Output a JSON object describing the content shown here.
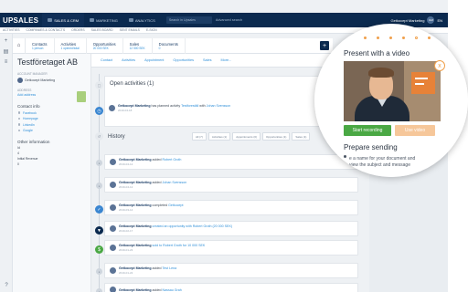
{
  "topbar": {
    "logo": "UPSALES",
    "nav": [
      {
        "label": "SALES & CRM"
      },
      {
        "label": "MARKETING"
      },
      {
        "label": "ANALYTICS"
      }
    ],
    "search_placeholder": "Search in Upsales",
    "advanced_search": "Advanced search",
    "user": "Getkocept Marketing",
    "avatar_initials": "GM",
    "user_suffix": "EN"
  },
  "subbar": [
    "ACTIVITIES",
    "COMPANIES & CONTACTS",
    "ORDERS",
    "SALES BOARD",
    "SENT EMAILS",
    "E-SIGN"
  ],
  "strip_icons": [
    "plus-icon",
    "calendar-icon",
    "list-icon"
  ],
  "help": "?",
  "account_row": {
    "tabs": [
      {
        "title": "Contacts",
        "sub": "1 person"
      },
      {
        "title": "Activities",
        "sub": "1 opened/total"
      },
      {
        "title": "Opportunities",
        "sub": "20 000 SEK"
      },
      {
        "title": "Sales",
        "sub": "12 500 SEK"
      },
      {
        "title": "Documents",
        "sub": "0"
      }
    ],
    "add": "+"
  },
  "company": {
    "name": "Testföretaget AB",
    "manager_label": "ACCOUNT MANAGER",
    "manager": "Getkocept Marketing",
    "address_label": "ADDRESS",
    "add_address": "Add address",
    "contact_title": "Contact info",
    "contact_links": [
      "Facebook",
      "Homepage",
      "LinkedIn",
      "Google"
    ],
    "other_title": "Other information",
    "other_lines": [
      "Id",
      "4",
      "Initial Revenue",
      "0"
    ]
  },
  "main": {
    "tabs": [
      "Contact",
      "Activities",
      "Appointment",
      "Opportunities",
      "Sales",
      "More..."
    ],
    "open_title": "Open activities (1)",
    "open_activity": {
      "user": "Getkocept Marketing",
      "text": "has planned activity",
      "link": "Testforeställ",
      "with": "with",
      "contact": "Johan Svensson",
      "date": "2019-04-18"
    },
    "history_title": "History",
    "filters": [
      "All (7)",
      "Activities (1)",
      "Appointments (0)",
      "Opportunities (1)",
      "Sales (1)"
    ],
    "history": [
      {
        "user": "Getkocept Marketing",
        "action": "added",
        "target": "Robert Groth",
        "date": "2019-04-12"
      },
      {
        "user": "Getkocept Marketing",
        "action": "added",
        "target": "Johan Svensson",
        "date": "2019-04-12"
      },
      {
        "user": "Getkocept Marketing",
        "action": "completed",
        "target": "Getkocept",
        "date": "2019-03-14"
      },
      {
        "user": "Getkocept Marketing",
        "action": "created an opportunity with",
        "target": "Robert Groth (20 000 SEK)",
        "date": "2019-02-17"
      },
      {
        "user": "Getkocept Marketing",
        "action": "sold to",
        "target": "Robert Groth for 10 000 SEK",
        "date": "2019-01-23"
      },
      {
        "user": "Getkocept Marketing",
        "action": "added",
        "target": "Test Lena",
        "date": "2019-01-22"
      },
      {
        "user": "Getkocept Marketing",
        "action": "added",
        "target": "Nassau Grah",
        "date": "2019-01-22"
      }
    ]
  },
  "magnifier": {
    "step_count": 6,
    "current_step": 5,
    "title": "Present with a video",
    "close": "x",
    "start_button": "Start recording",
    "use_button": "Use video",
    "section_title": "Prepare sending",
    "line1": "e a name for your document and",
    "line2": "view the subject and message"
  },
  "colors": {
    "navy": "#0b2a4f",
    "link_blue": "#2f8fd8",
    "green": "#4aa844",
    "orange": "#f0a04b"
  }
}
